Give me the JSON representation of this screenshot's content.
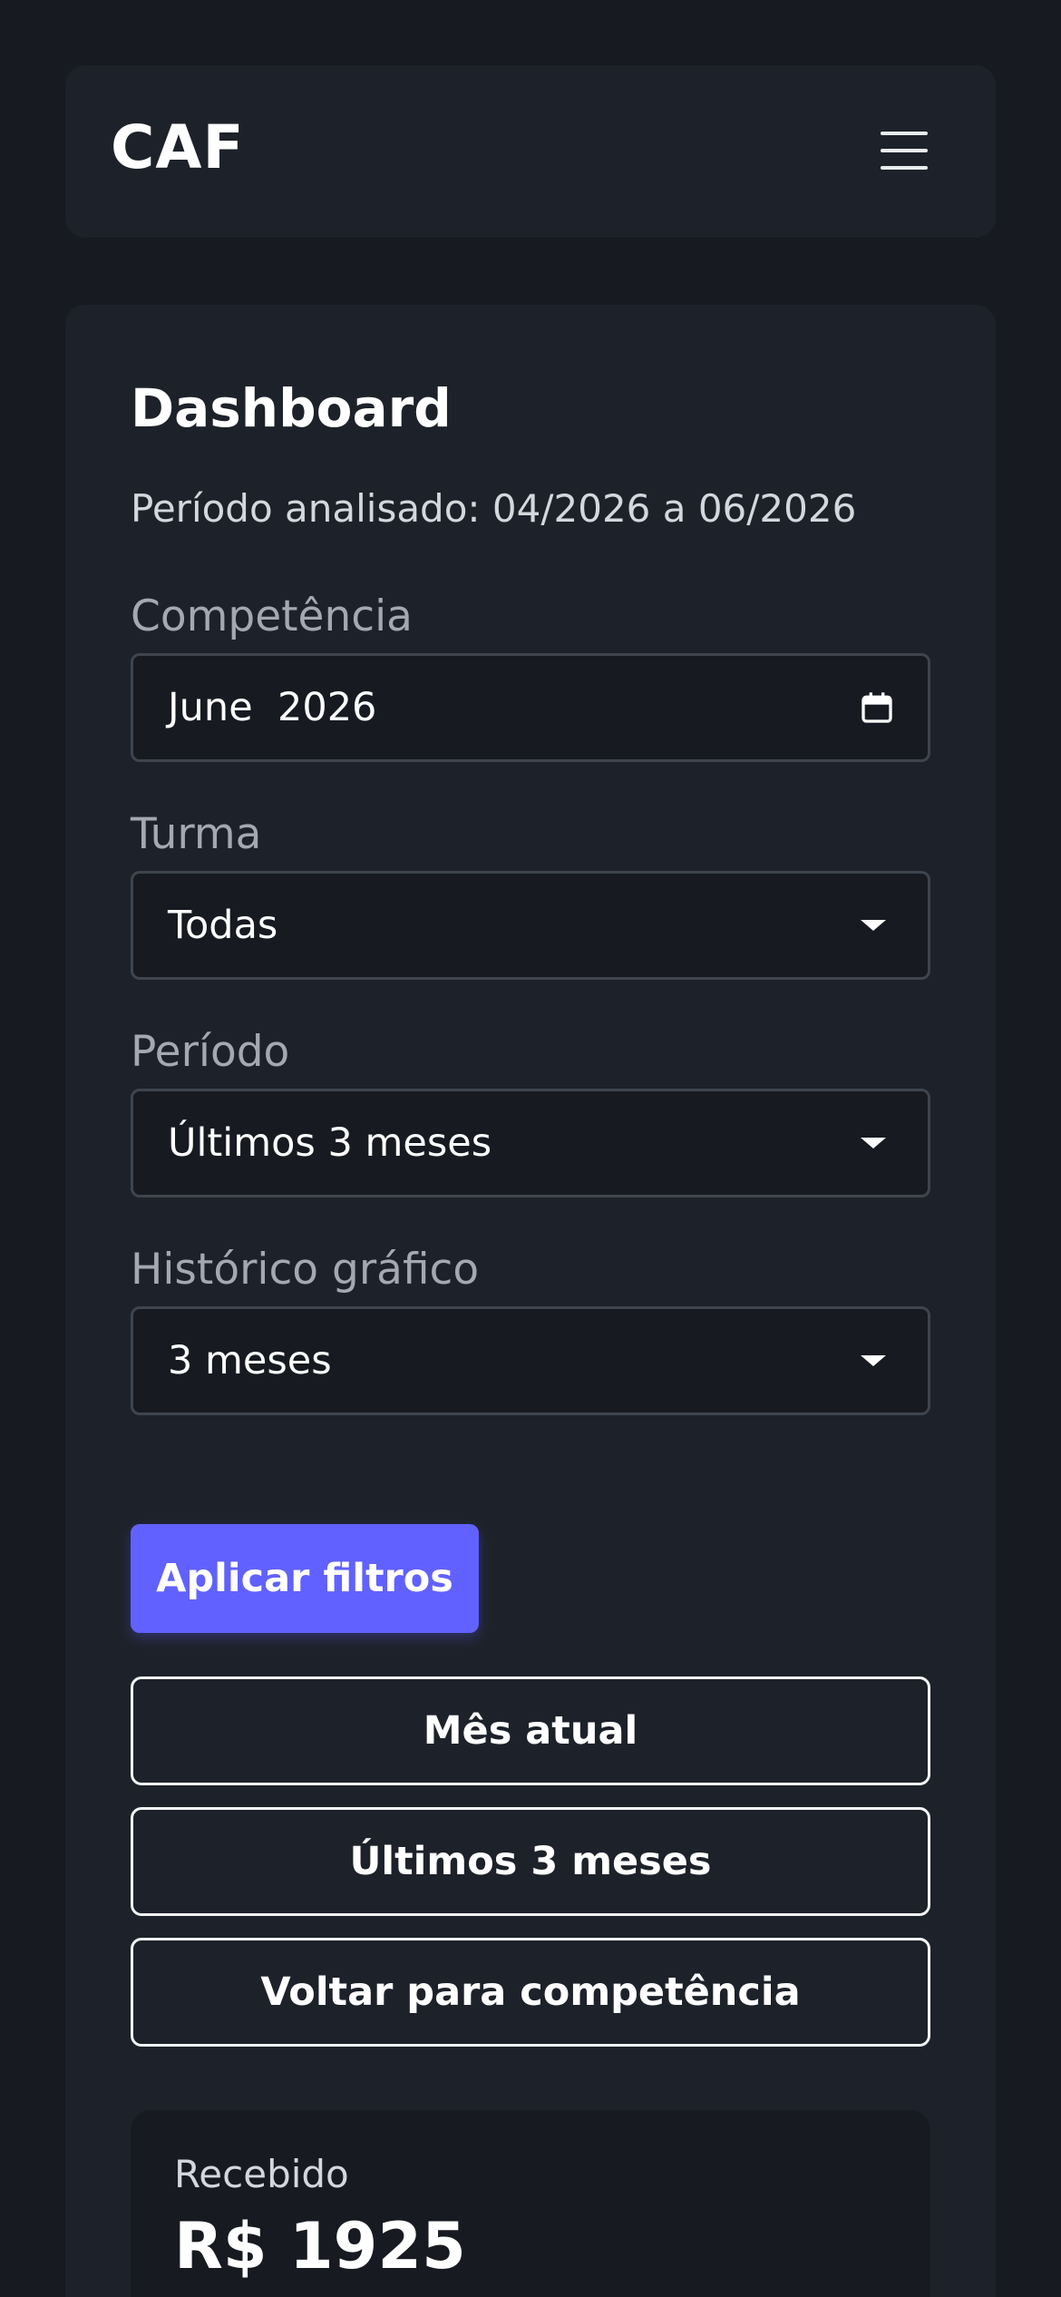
{
  "header": {
    "brand": "CAF",
    "menu_icon": "hamburger-menu-icon"
  },
  "dashboard": {
    "title": "Dashboard",
    "period_text": "Período analisado: 04/2026 a 06/2026"
  },
  "filters": {
    "competencia": {
      "label": "Competência",
      "value": "June  2026",
      "icon": "calendar-icon"
    },
    "turma": {
      "label": "Turma",
      "value": "Todas",
      "icon": "caret-down-icon"
    },
    "periodo": {
      "label": "Período",
      "value": "Últimos 3 meses",
      "icon": "caret-down-icon"
    },
    "historico": {
      "label": "Histórico gráfico",
      "value": "3 meses",
      "icon": "caret-down-icon"
    }
  },
  "actions": {
    "apply": "Aplicar filtros",
    "current_month": "Mês atual",
    "last_3_months": "Últimos 3 meses",
    "back": "Voltar para competência"
  },
  "summary": {
    "received_label": "Recebido",
    "received_value": "R$ 1925"
  },
  "colors": {
    "background": "#171b21",
    "card": "#1d222a",
    "accent": "#6161ff",
    "muted_text": "#a3a9b1"
  }
}
